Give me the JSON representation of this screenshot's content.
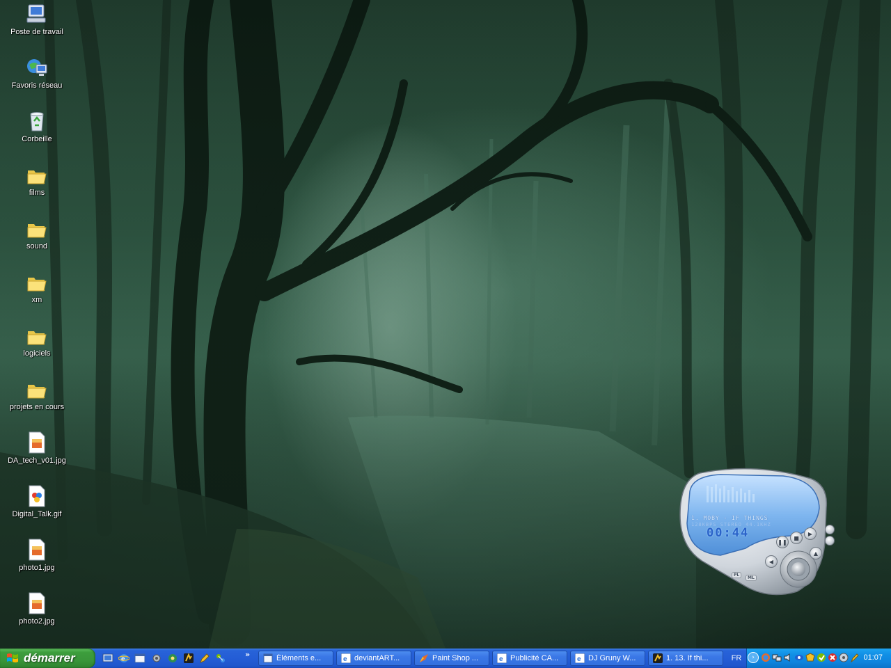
{
  "desktop": {
    "icons": [
      {
        "label": "Poste de travail",
        "icon": "my-computer-icon"
      },
      {
        "label": "Favoris réseau",
        "icon": "network-places-icon"
      },
      {
        "label": "Corbeille",
        "icon": "recycle-bin-icon"
      },
      {
        "label": "films",
        "icon": "folder-icon"
      },
      {
        "label": "sound",
        "icon": "folder-icon"
      },
      {
        "label": "xm",
        "icon": "folder-icon"
      },
      {
        "label": "logiciels",
        "icon": "folder-icon"
      },
      {
        "label": "projets en cours",
        "icon": "folder-icon"
      },
      {
        "label": "DA_tech_v01.jpg",
        "icon": "jpg-file-icon"
      },
      {
        "label": "Digital_Talk.gif",
        "icon": "gif-file-icon"
      },
      {
        "label": "photo1.jpg",
        "icon": "jpg-file-icon"
      },
      {
        "label": "photo2.jpg",
        "icon": "jpg-file-icon"
      }
    ]
  },
  "player": {
    "track": "1. MOBY - IF THINGS",
    "info": "128KBPS STEREO 44.1KHZ",
    "time": "00:44",
    "pl_label": "PL",
    "ml_label": "ML"
  },
  "taskbar": {
    "start_label": "démarrer",
    "quick_launch_more": "»",
    "tasks": [
      {
        "label": "Éléments e...",
        "icon": "explorer-window-icon"
      },
      {
        "label": "deviantART...",
        "icon": "ie-icon"
      },
      {
        "label": "Paint Shop ...",
        "icon": "paint-shop-icon"
      },
      {
        "label": "Publicité CA...",
        "icon": "ie-icon"
      },
      {
        "label": "DJ Gruny W...",
        "icon": "ie-icon"
      },
      {
        "label": "1. 13. If thi...",
        "icon": "winamp-icon"
      }
    ],
    "language": "FR",
    "clock": "01:07"
  },
  "colors": {
    "taskbar_blue": "#245dd6",
    "start_green": "#3a963a",
    "tray_blue": "#0e84dd",
    "player_lcd": "#7fb6ef"
  }
}
